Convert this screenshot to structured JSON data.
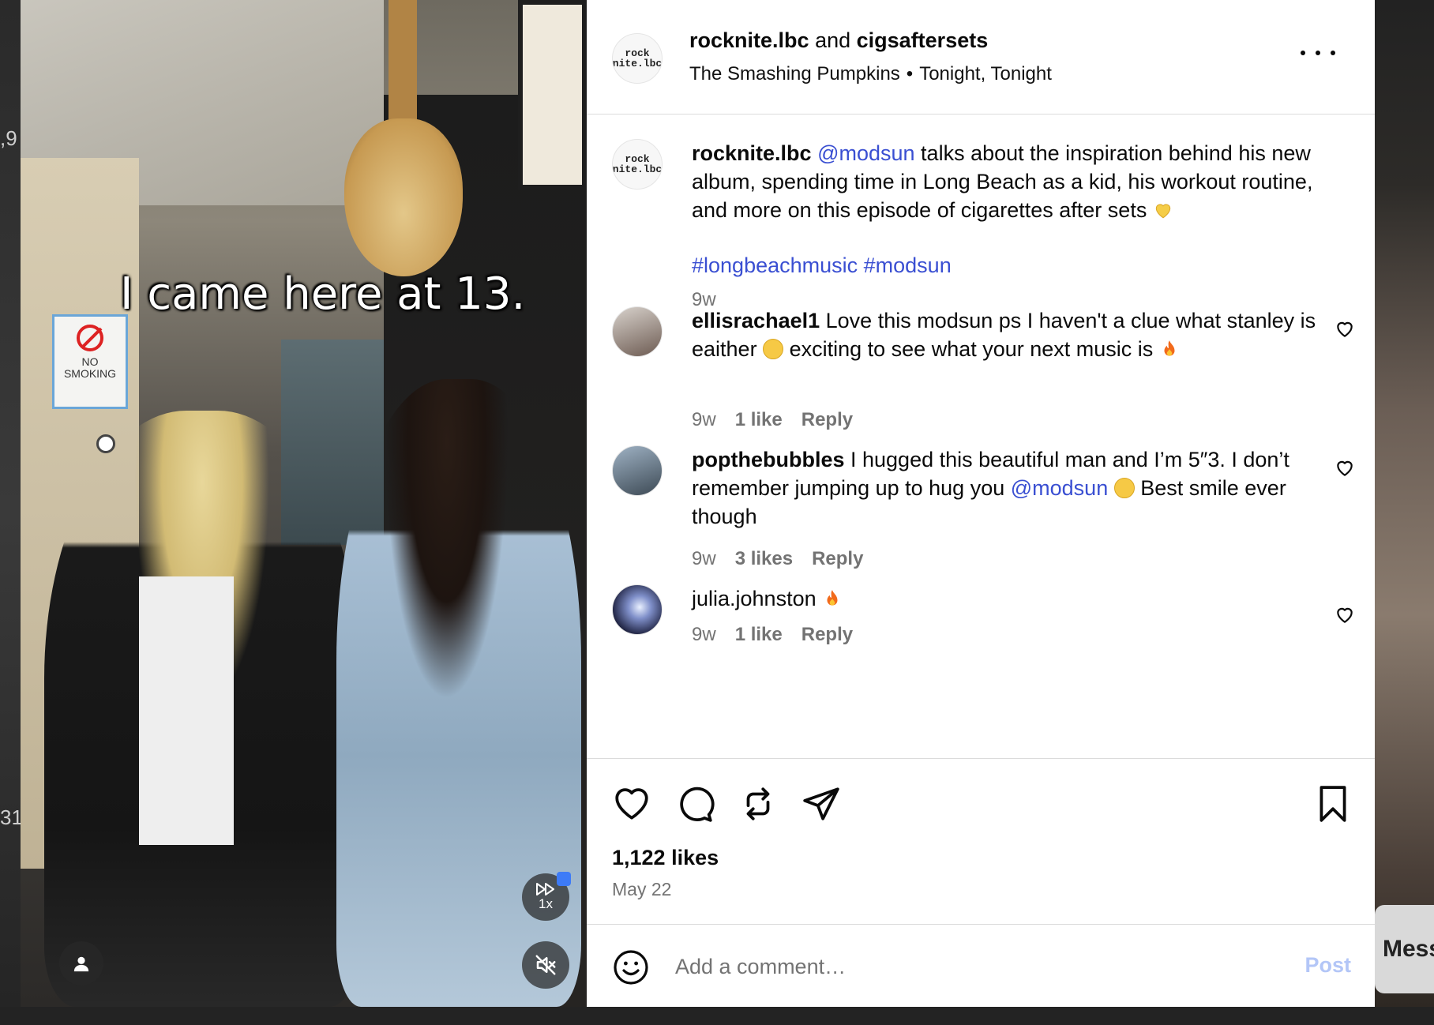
{
  "background": {
    "left_edge_numbers": [
      ",9",
      "31."
    ],
    "messages_label": "Messages"
  },
  "video": {
    "caption": "I came here at 13.",
    "sign_text": "NO SMOKING",
    "speed_label": "1x",
    "icons": {
      "speed": "fast-forward-icon",
      "mute": "speaker-muted-icon",
      "user": "user-silhouette-icon"
    }
  },
  "post": {
    "header": {
      "author": "rocknite.lbc",
      "connector": "and",
      "collaborator": "cigsaftersets",
      "artist": "The Smashing Pumpkins",
      "track": "Tonight, Tonight",
      "avatar_text": "rock nite.lbc"
    },
    "caption": {
      "user": "rocknite.lbc",
      "mention": "@modsun",
      "text": "talks about the inspiration behind his new album, spending time in Long Beach as a kid, his workout routine, and more on this episode of cigarettes after sets",
      "emoji": "yellow-heart",
      "hashtags": "#longbeachmusic #modsun",
      "time": "9w"
    },
    "comments": [
      {
        "user": "ellisrachael1",
        "text_before": "Love this modsun ps I haven't a clue what stanley is eaither",
        "text_after": "exciting to see what your next music is",
        "time": "9w",
        "likes": "1 like",
        "reply": "Reply"
      },
      {
        "user": "popthebubbles",
        "text_before": "I hugged this beautiful man and I’m 5″3. I don’t remember jumping up to hug you",
        "mention": "@modsun",
        "text_after": "Best smile ever though",
        "time": "9w",
        "likes": "3 likes",
        "reply": "Reply"
      },
      {
        "user": "julia.johnston",
        "text_before": "",
        "time": "9w",
        "likes": "1 like",
        "reply": "Reply"
      }
    ],
    "likes": "1,122 likes",
    "date": "May 22",
    "comment_box": {
      "placeholder": "Add a comment…",
      "post_label": "Post"
    }
  },
  "colors": {
    "link": "#3a4fd2",
    "muted": "#737373",
    "post_button_disabled": "#b3c6f7"
  }
}
